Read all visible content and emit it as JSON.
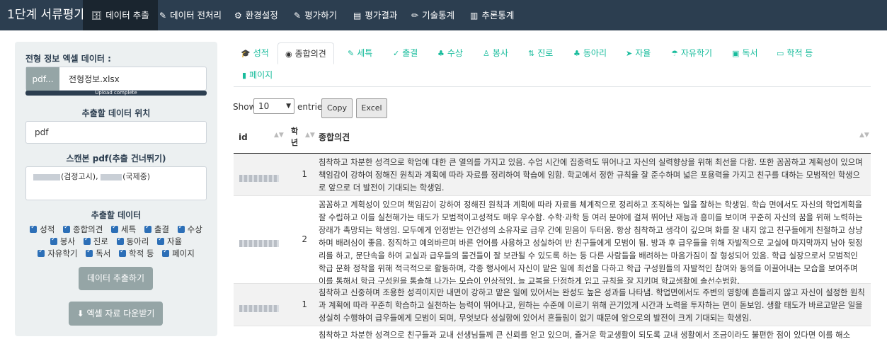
{
  "navbar": {
    "brand": "1단계 서류평가",
    "items": [
      {
        "label": "데이터 추출",
        "icon": "database-icon",
        "glyph": "🗄"
      },
      {
        "label": "데이터 전처리",
        "icon": "magic-icon",
        "glyph": "✎"
      },
      {
        "label": "환경설정",
        "icon": "cogs-icon",
        "glyph": "⚙"
      },
      {
        "label": "평가하기",
        "icon": "pen-icon",
        "glyph": "✎"
      },
      {
        "label": "평가결과",
        "icon": "file-icon",
        "glyph": "▤"
      },
      {
        "label": "기술통계",
        "icon": "pencil-icon",
        "glyph": "✏"
      },
      {
        "label": "추론통계",
        "icon": "bar-chart-icon",
        "glyph": "▥"
      }
    ]
  },
  "sidebar": {
    "excel_label": "전형 정보 엑셀 데이터 :",
    "file_button": "pdf...",
    "file_name": "전형정보.xlsx",
    "upload_status": "Upload complete",
    "location_label": "추출할 데이터 위치",
    "location_value": "pdf",
    "skip_label": "스캔본 pdf(추출 건너뛰기)",
    "skip_value_1": "(검정고시),",
    "skip_value_2": "(국제중)",
    "data_label": "추출할 데이터",
    "checkboxes": [
      "성적",
      "종합의견",
      "세특",
      "출결",
      "수상",
      "봉사",
      "진로",
      "동아리",
      "자율",
      "자유학기",
      "독서",
      "학적 등",
      "페이지"
    ],
    "extract_button": "데이터 추출하기",
    "download_button": "엑셀 자료 다운받기"
  },
  "tabs": [
    {
      "label": "성적",
      "icon": "graduation-icon",
      "glyph": "🎓"
    },
    {
      "label": "종합의견",
      "icon": "user-circle-icon",
      "glyph": "◉"
    },
    {
      "label": "세특",
      "icon": "edit-icon",
      "glyph": "✎"
    },
    {
      "label": "출결",
      "icon": "check-icon",
      "glyph": "✓"
    },
    {
      "label": "수상",
      "icon": "sitemap-icon",
      "glyph": "♣"
    },
    {
      "label": "봉사",
      "icon": "hands-icon",
      "glyph": "♙"
    },
    {
      "label": "진로",
      "icon": "route-icon",
      "glyph": "⇅"
    },
    {
      "label": "동아리",
      "icon": "network-icon",
      "glyph": "♣"
    },
    {
      "label": "자율",
      "icon": "paper-plane-icon",
      "glyph": "➤"
    },
    {
      "label": "자유학기",
      "icon": "umbrella-beach-icon",
      "glyph": "☂"
    },
    {
      "label": "독서",
      "icon": "cubes-icon",
      "glyph": "▣"
    },
    {
      "label": "학적 등",
      "icon": "id-card-icon",
      "glyph": "▭"
    },
    {
      "label": "페이지",
      "icon": "book-icon",
      "glyph": "▮"
    }
  ],
  "table_controls": {
    "show_label": "Show",
    "page_length": "10",
    "entries_label": "entries",
    "copy_button": "Copy",
    "excel_button": "Excel"
  },
  "table": {
    "headers": [
      "id",
      "학년",
      "종합의견"
    ],
    "rows": [
      {
        "grade": "1",
        "text": "침착하고 차분한 성격으로 학업에 대한 큰 열의를 가지고 있음. 수업 시간에 집중력도 뛰어나고 자신의 실력향상을 위해 최선을 다함. 또한 꼼꼼하고 계획성이 있으며 책임감이 강하여 정해진 원칙과 계획에 따라 자료를 정리하여 학습에 임함. 학교에서 정한 규칙을 잘 준수하며 넓은 포용력을 가지고 친구를 대하는 모범적인 학생으로 앞으로 더 발전이 기대되는 학생임."
      },
      {
        "grade": "2",
        "text": "꼼꼼하고 계획성이 있으며 책임감이 강하여 정해진 원칙과 계획에 따라 자료를 체계적으로 정리하고 조직하는 일을 잘하는 학생임. 학습 면에서도 자신의 학업계획을 잘 수립하고 이를 실천해가는 태도가 모범적이고성적도 매우 우수함. 수학·과학 등 여러 분야에 걸쳐 뛰어난 재능과 흥미를 보이며 꾸준히 자신의 꿈을 위해 노력하는 장래가 촉망되는 학생임. 모두에게 인정받는 인간성의 소유자로 급우 간에 믿음이 두터움. 항상 침착하고 생각이 깊으며 화를 잘 내지 않고 친구들에게 친절하고 상냥하며 배려심이 좋음. 정직하고 예의바르며 바른 언어를 사용하고 성실하여 반 친구들에게 모범이 됨. 방과 후 급우들을 위해 자발적으로 교실에 마지막까지 남아 뒷정리를 하고, 문단속을 하여 교실과 급우들의 물건들이 잘 보관될 수 있도록 하는 등 다른 사람들을 배려하는 마음가짐이 잘 형성되어 있음. 학급 실장으로서 모범적인 학급 문화 정착을 위해 적극적으로 활동하며, 각종 행사에서 자신이 맡은 일에 최선을 다하고 학급 구성원들의 자발적인 참여와 동의를 이끌어내는 모습을 보여주며 이를 통해서 학급 구성원을 통솔해 나가는 모습이 인상적임. 늘 교복을 단정하게 입고 규칙을 잘 지키며 학교생활에 솔선수범함."
      },
      {
        "grade": "1",
        "text": "침착하고 신중하며 조용한 성격이지만 내면이 강하고 맡은 일에 있어서는 완성도 높은 성과를 나타냄. 학업면에서도 주변의 영향에 흔들리지 않고 자신이 설정한 원칙과 계획에 따라 꾸준히 학습하고 실천하는 능력이 뛰어나고, 원하는 수준에 이르기 위해 끈기있게 시간과 노력을 투자하는 면이 돋보임. 생활 태도가 바르고맡은 일을 성실히 수행하여 급우들에게 모범이 되며, 무엇보다 성실함에 있어서 흔들림이 없기 때문에 앞으로의 발전이 크게 기대되는 학생임."
      },
      {
        "grade": "",
        "text": "침착하고 차분한 성격으로 친구들과 교내 선생님들께 큰 신뢰를 얻고 있으며, 즐거운 학교생활이 되도록 교내 생활에서 조금이라도 불편한 점이 있다면 이를 해소"
      }
    ]
  }
}
